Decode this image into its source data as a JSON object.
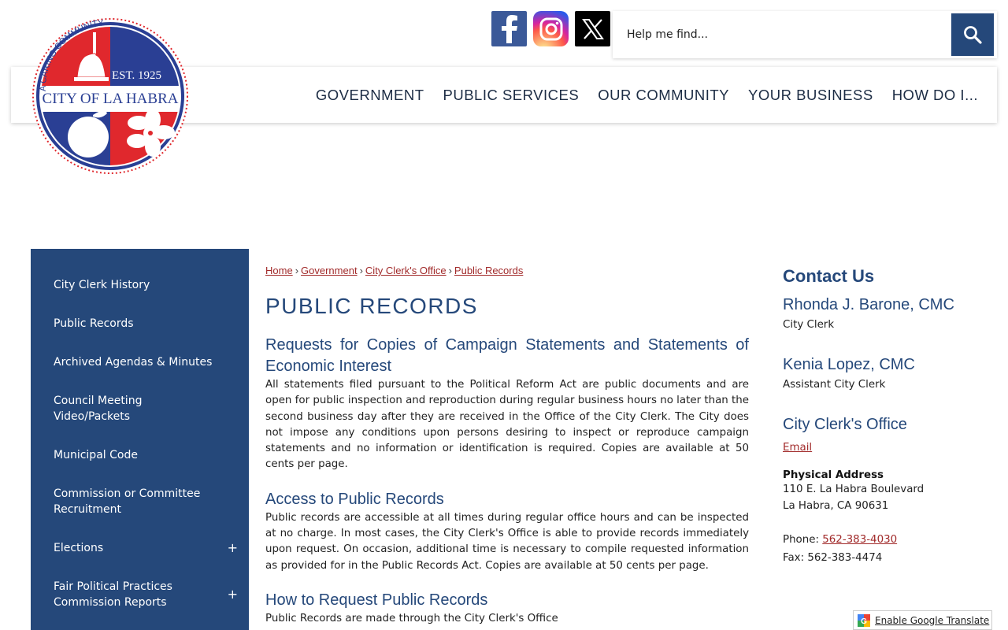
{
  "header": {
    "logo": {
      "arc_text": "A CARING COMMUNITY",
      "est": "EST. 1925",
      "city": "CITY OF LA HABRA"
    },
    "social": [
      {
        "icon": "facebook-icon"
      },
      {
        "icon": "instagram-icon"
      },
      {
        "icon": "x-twitter-icon"
      }
    ],
    "search": {
      "placeholder": "Help me find...",
      "value": ""
    },
    "nav": [
      "GOVERNMENT",
      "PUBLIC SERVICES",
      "OUR COMMUNITY",
      "YOUR BUSINESS",
      "HOW DO I..."
    ]
  },
  "sidebar": {
    "items": [
      {
        "label": "City Clerk History",
        "expand": ""
      },
      {
        "label": "Public Records",
        "expand": ""
      },
      {
        "label": "Archived Agendas & Minutes",
        "expand": ""
      },
      {
        "label": "Council Meeting Video/Packets",
        "expand": ""
      },
      {
        "label": "Municipal Code",
        "expand": ""
      },
      {
        "label": "Commission or Committee Recruitment",
        "expand": ""
      },
      {
        "label": "Elections",
        "expand": "+"
      },
      {
        "label": "Fair Political Practices Commission Reports",
        "expand": "+"
      }
    ]
  },
  "breadcrumb": {
    "items": [
      "Home",
      "Government",
      "City Clerk's Office",
      "Public Records"
    ],
    "separator": "›"
  },
  "main": {
    "title": "PUBLIC RECORDS",
    "sections": [
      {
        "heading": "Requests for Copies of Campaign Statements and Statements of Economic Interest",
        "body": "All statements filed pursuant to the Political Reform Act are public documents and are open for public inspection and reproduction during regular business hours no later than the second business day after they are received in the Office of the City Clerk. The City does not impose any conditions upon persons desiring to inspect or reproduce campaign statements and no information or identification is required. Copies are available at 50 cents per page."
      },
      {
        "heading": "Access to Public Records",
        "body": "Public records are accessible at all times during regular office hours and can be inspected at no charge. In most cases, the City Clerk's Office is able to provide records immediately upon request. On occasion, additional time is necessary to compile requested information as provided for in the Public Records Act. Copies are available at 50 cents per page."
      },
      {
        "heading": "How to Request Public Records",
        "body": "Public Records are made through the City Clerk's Office"
      }
    ]
  },
  "contact": {
    "title": "Contact Us",
    "people": [
      {
        "name": "Rhonda J. Barone, CMC",
        "role": "City Clerk"
      },
      {
        "name": "Kenia Lopez, CMC",
        "role": "Assistant City Clerk"
      }
    ],
    "office": {
      "name": "City Clerk's Office",
      "email_label": "Email",
      "address_label": "Physical Address",
      "address_line1": "110 E. La Habra Boulevard",
      "address_line2": "La Habra, CA 90631",
      "phone_label": "Phone:",
      "phone": "562-383-4030",
      "fax": "Fax: 562-383-4474"
    }
  },
  "translate": {
    "label": "Enable Google Translate"
  },
  "colors": {
    "primary": "#25487a",
    "link": "#a12a2a",
    "logo_red": "#e0282d",
    "logo_blue": "#2a3f94"
  }
}
